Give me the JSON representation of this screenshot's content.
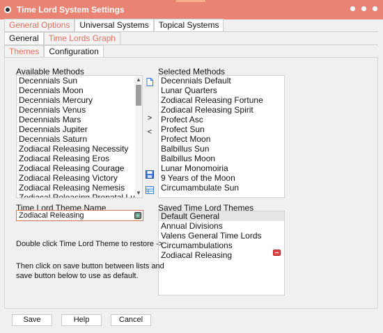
{
  "window": {
    "title": "Time Lord System Settings"
  },
  "tabs_top": [
    "General Options",
    "Universal Systems",
    "Topical Systems"
  ],
  "tabs_second": [
    "General",
    "Time Lords Graph"
  ],
  "tabs_third": [
    "Themes",
    "Configuration"
  ],
  "available": {
    "label": "Available Methods",
    "items": [
      "Decennials Sun",
      "Decennials Moon",
      "Decennials Mercury",
      "Decennials Venus",
      "Decennials Mars",
      "Decennials Jupiter",
      "Decennials Saturn",
      "Zodiacal Releasing Necessity",
      "Zodiacal Releasing Eros",
      "Zodiacal Releasing Courage",
      "Zodiacal Releasing Victory",
      "Zodiacal Releasing Nemesis",
      "Zodiacal Releasing Prenatal Lunation"
    ]
  },
  "selected": {
    "label": "Selected Methods",
    "items": [
      "Decennials Default",
      "Lunar Quarters",
      "Zodiacal Releasing Fortune",
      "Zodiacal Releasing Spirit",
      "Profect Asc",
      "Profect Sun",
      "Profect Moon",
      "Balbillus Sun",
      "Balbillus Moon",
      "Lunar Monomoiria",
      "9 Years of the Moon",
      "Circumambulate Sun"
    ]
  },
  "middle_buttons": {
    "add": ">",
    "remove": "<"
  },
  "theme_name": {
    "label": "Time Lord Theme Name",
    "value": "Zodiacal Releasing"
  },
  "saved": {
    "label": "Saved Time Lord Themes",
    "items": [
      "Default General",
      "Annual Divisions",
      "Valens General Time Lords",
      "Circumambulations",
      "Zodiacal Releasing"
    ]
  },
  "help": {
    "line1": "Double click Time Lord Theme to restore ->",
    "line2": "Then click on save button between lists and",
    "line3": "save button below to use as default."
  },
  "buttons": {
    "save": "Save",
    "help": "Help",
    "cancel": "Cancel"
  },
  "colors": {
    "accent": "#e98373",
    "tab_active": "#e0705e"
  }
}
